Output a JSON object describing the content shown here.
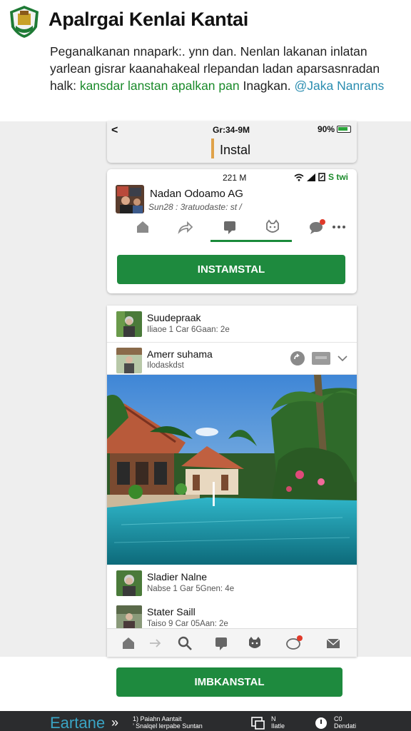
{
  "header": {
    "title": "Apalrgai Kenlai Kantai",
    "desc_plain1": "Peganalkanan nnapark:. ynn dan. Nenlan  lakanan inlatan yarlean gisrar kaanahakeal rlepandan ladan aparsasnradan halk: ",
    "desc_green": "kansdar lanstan  apalkan pan",
    "desc_plain2": " Inagkan. ",
    "desc_teal": "@Jaka Nanrans"
  },
  "status_bar": {
    "back": "<",
    "time": "Gr:34-9M",
    "battery": "90%"
  },
  "top_bar": {
    "title": "Instal"
  },
  "app_card": {
    "time": "221 M",
    "status": "S twi",
    "name": "Nadan Odoamo AG",
    "sub": "Sun28 : 3ratuodaste: st /",
    "install_label": "INSTAMSTAL"
  },
  "list": {
    "rows": [
      {
        "name": "Suudepraak",
        "sub": "Iliaoe 1 Car 6Gaan: 2e"
      },
      {
        "name": "Amerr suhama",
        "sub": "Ilodaskdst"
      }
    ],
    "rows_after": [
      {
        "name": "Sladier Nalne",
        "sub": "Nabse 1 Gar 5Gnen: 4e"
      },
      {
        "name": "Stater Saill",
        "sub": "Taiso 9 Car 05Aan: 2e"
      }
    ]
  },
  "bottom_button": "IMBKANSTAL",
  "footer": {
    "brand": "Eartane",
    "arrow": "»",
    "text_line1": "1) Paiahn Aantait",
    "text_line2": "’ Snalqel lerpabe Suntan",
    "item1_line1": "N",
    "item1_line2": "Ilatle",
    "item2_line1": "C0",
    "item2_line2": "Dendati"
  },
  "colors": {
    "accent_green": "#1e8a3e",
    "brand_teal": "#3aa4c4",
    "badge_red": "#e03a2a"
  },
  "icons": [
    "logo-icon",
    "back-icon",
    "wifi-icon",
    "signal-icon",
    "home-icon",
    "share-icon",
    "video-icon",
    "cat-icon",
    "chat-icon",
    "more-icon",
    "search-icon",
    "mail-icon",
    "chevron-down-icon"
  ]
}
